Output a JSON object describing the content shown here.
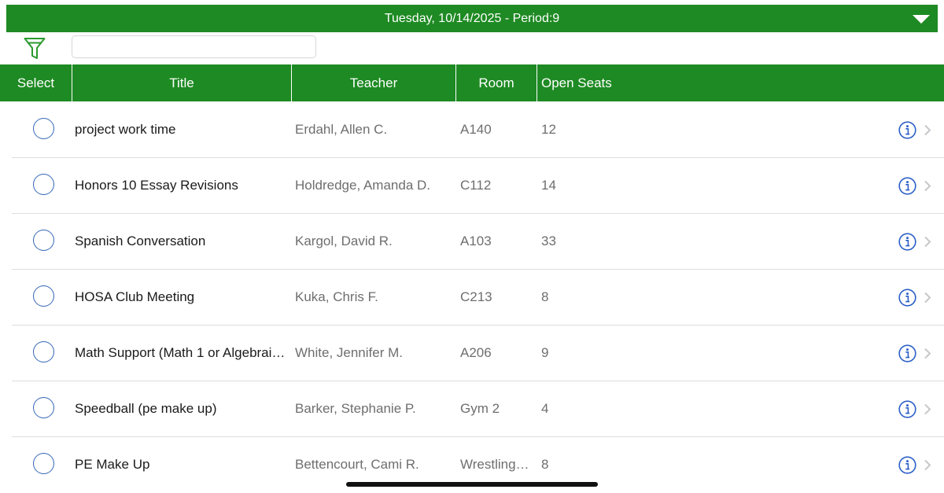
{
  "top_bar": {
    "date_period": "Tuesday, 10/14/2025 - Period:9"
  },
  "filter": {
    "search_value": ""
  },
  "table": {
    "headers": {
      "select": "Select",
      "title": "Title",
      "teacher": "Teacher",
      "room": "Room",
      "open_seats": "Open Seats"
    },
    "rows": [
      {
        "title": "project work time",
        "teacher": "Erdahl, Allen C.",
        "room": "A140",
        "open_seats": "12"
      },
      {
        "title": "Honors 10 Essay Revisions",
        "teacher": "Holdredge, Amanda D.",
        "room": "C112",
        "open_seats": "14"
      },
      {
        "title": "Spanish Conversation",
        "teacher": "Kargol, David R.",
        "room": "A103",
        "open_seats": "33"
      },
      {
        "title": "HOSA Club Meeting",
        "teacher": "Kuka, Chris F.",
        "room": "C213",
        "open_seats": "8"
      },
      {
        "title": "Math Support (Math 1 or Algebrai…",
        "teacher": "White, Jennifer M.",
        "room": "A206",
        "open_seats": "9"
      },
      {
        "title": "Speedball (pe make up)",
        "teacher": "Barker, Stephanie P.",
        "room": "Gym 2",
        "open_seats": "4"
      },
      {
        "title": "PE Make Up",
        "teacher": "Bettencourt, Cami R.",
        "room": "Wrestling…",
        "open_seats": "8"
      }
    ]
  },
  "icons": {
    "dropdown": "caret-down-icon",
    "filter": "filter-icon",
    "info": "info-icon",
    "row_chevron": "chevron-right-icon"
  },
  "colors": {
    "header_green": "#1e8a23",
    "radio_blue": "#3566b8",
    "info_blue": "#2b5fc7",
    "chevron_gray": "#c7c7cc"
  }
}
